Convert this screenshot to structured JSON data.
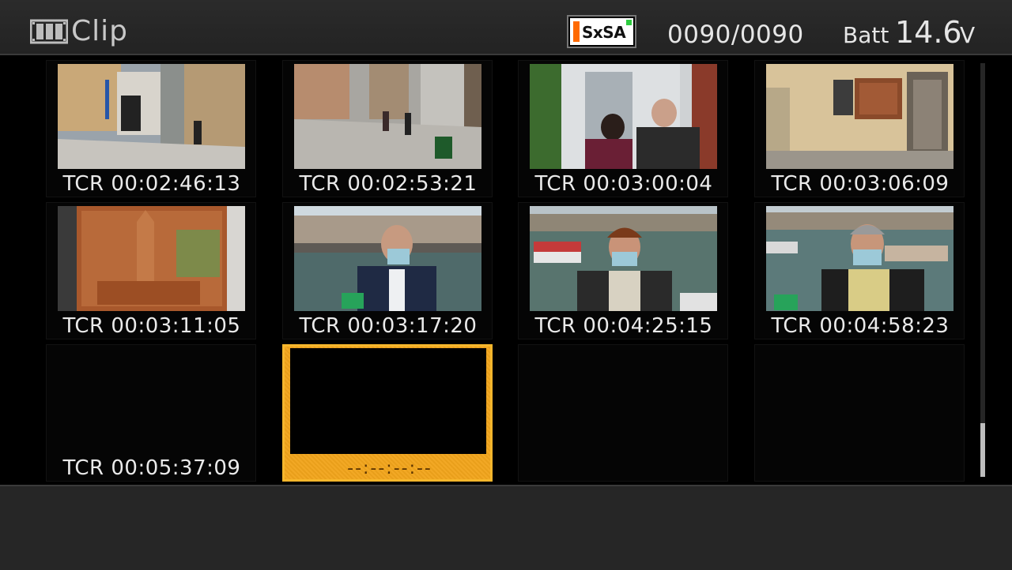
{
  "header": {
    "title": "Clip",
    "title_icon": "film-strip-icon",
    "media_badge": "SxSA",
    "clip_counter": "0090/0090",
    "battery_label": "Batt",
    "battery_value": "14.6",
    "battery_unit": "V"
  },
  "clips": [
    {
      "timecode": "TCR 00:02:46:13",
      "scene": "street-scene-buildings"
    },
    {
      "timecode": "TCR 00:02:53:21",
      "scene": "street-scene-pedestrians"
    },
    {
      "timecode": "TCR 00:03:00:04",
      "scene": "two-people-masks"
    },
    {
      "timecode": "TCR 00:03:06:09",
      "scene": "building-facade-mural"
    },
    {
      "timecode": "TCR 00:03:11:05",
      "scene": "malpica-mural"
    },
    {
      "timecode": "TCR 00:03:17:20",
      "scene": "interview-man-harbor"
    },
    {
      "timecode": "TCR 00:04:25:15",
      "scene": "interview-woman-harbor"
    },
    {
      "timecode": "TCR 00:04:58:23",
      "scene": "interview-man-harbor-2"
    },
    {
      "timecode": "TCR 00:05:37:09",
      "scene": "blank"
    },
    {
      "timecode": "--:--:--:--",
      "scene": "blank-selected",
      "selected": true
    }
  ],
  "colors": {
    "selection": "#f2a51c",
    "media_badge_stripe": "#ff6a00",
    "media_badge_led": "#2ecc40"
  }
}
